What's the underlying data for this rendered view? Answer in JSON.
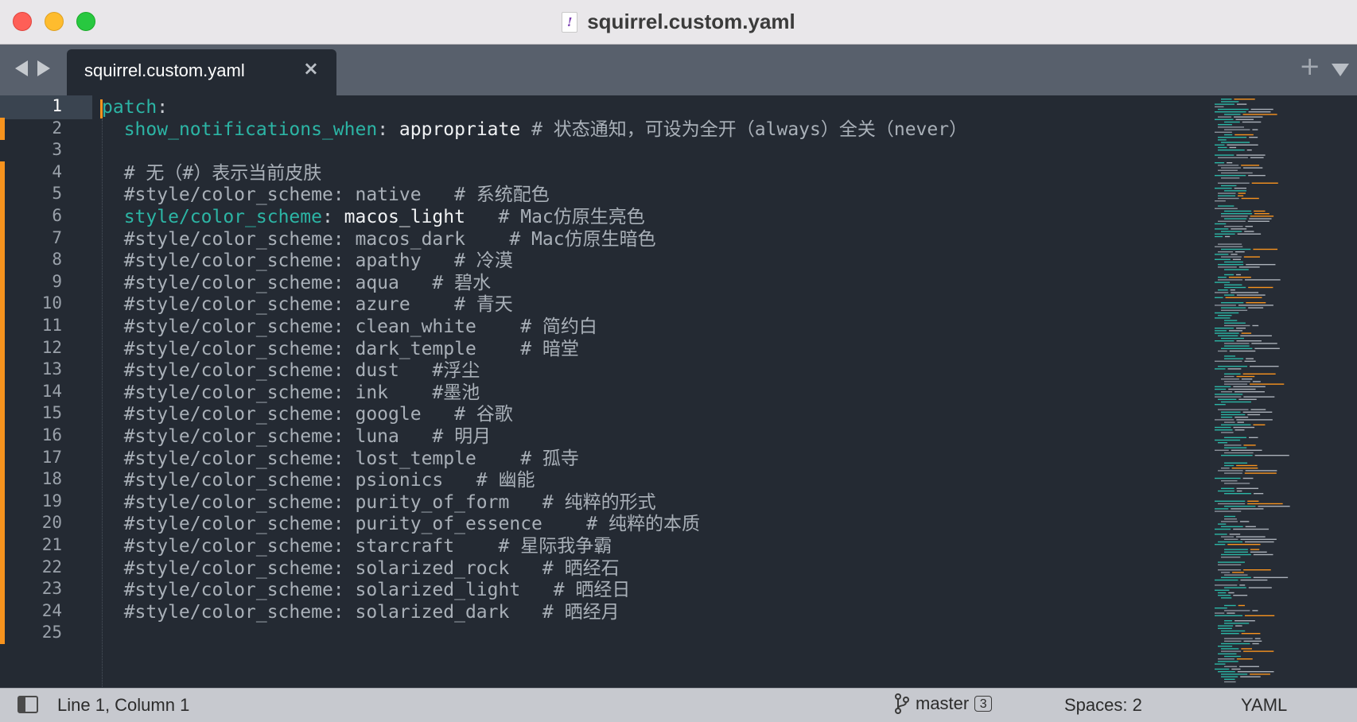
{
  "window": {
    "title": "squirrel.custom.yaml",
    "file_icon_glyph": "!"
  },
  "tabbar": {
    "tab_label": "squirrel.custom.yaml",
    "close_glyph": "×",
    "new_tab_glyph": "+"
  },
  "editor": {
    "current_line": 1,
    "lines": [
      {
        "num": "1",
        "parts": [
          {
            "t": "patch",
            "c": "key"
          },
          {
            "t": ":",
            "c": "sep"
          }
        ],
        "marked": false
      },
      {
        "num": "2",
        "parts": [
          {
            "t": "  ",
            "c": "cmt"
          },
          {
            "t": "show_notifications_when",
            "c": "key"
          },
          {
            "t": ": ",
            "c": "sep"
          },
          {
            "t": "appropriate",
            "c": "val"
          },
          {
            "t": " # 状态通知，可设为全开（always）全关（never）",
            "c": "cmt"
          }
        ],
        "marked": true
      },
      {
        "num": "3",
        "parts": [],
        "marked": false
      },
      {
        "num": "4",
        "parts": [
          {
            "t": "  # 无（#）表示当前皮肤",
            "c": "cmt"
          }
        ],
        "marked": true
      },
      {
        "num": "5",
        "parts": [
          {
            "t": "  #style/color_scheme: native   # 系统配色",
            "c": "cmt"
          }
        ],
        "marked": true
      },
      {
        "num": "6",
        "parts": [
          {
            "t": "  ",
            "c": "cmt"
          },
          {
            "t": "style/color_scheme",
            "c": "key"
          },
          {
            "t": ": ",
            "c": "sep"
          },
          {
            "t": "macos_light",
            "c": "val"
          },
          {
            "t": "   # Mac仿原生亮色",
            "c": "cmt"
          }
        ],
        "marked": true
      },
      {
        "num": "7",
        "parts": [
          {
            "t": "  #style/color_scheme: macos_dark    # Mac仿原生暗色",
            "c": "cmt"
          }
        ],
        "marked": true
      },
      {
        "num": "8",
        "parts": [
          {
            "t": "  #style/color_scheme: apathy   # 冷漠",
            "c": "cmt"
          }
        ],
        "marked": true
      },
      {
        "num": "9",
        "parts": [
          {
            "t": "  #style/color_scheme: aqua   # 碧水",
            "c": "cmt"
          }
        ],
        "marked": true
      },
      {
        "num": "10",
        "parts": [
          {
            "t": "  #style/color_scheme: azure    # 青天",
            "c": "cmt"
          }
        ],
        "marked": true
      },
      {
        "num": "11",
        "parts": [
          {
            "t": "  #style/color_scheme: clean_white    # 简约白",
            "c": "cmt"
          }
        ],
        "marked": true
      },
      {
        "num": "12",
        "parts": [
          {
            "t": "  #style/color_scheme: dark_temple    # 暗堂",
            "c": "cmt"
          }
        ],
        "marked": true
      },
      {
        "num": "13",
        "parts": [
          {
            "t": "  #style/color_scheme: dust   #浮尘",
            "c": "cmt"
          }
        ],
        "marked": true
      },
      {
        "num": "14",
        "parts": [
          {
            "t": "  #style/color_scheme: ink    #墨池",
            "c": "cmt"
          }
        ],
        "marked": true
      },
      {
        "num": "15",
        "parts": [
          {
            "t": "  #style/color_scheme: google   # 谷歌",
            "c": "cmt"
          }
        ],
        "marked": true
      },
      {
        "num": "16",
        "parts": [
          {
            "t": "  #style/color_scheme: luna   # 明月",
            "c": "cmt"
          }
        ],
        "marked": true
      },
      {
        "num": "17",
        "parts": [
          {
            "t": "  #style/color_scheme: lost_temple    # 孤寺",
            "c": "cmt"
          }
        ],
        "marked": true
      },
      {
        "num": "18",
        "parts": [
          {
            "t": "  #style/color_scheme: psionics   # 幽能",
            "c": "cmt"
          }
        ],
        "marked": true
      },
      {
        "num": "19",
        "parts": [
          {
            "t": "  #style/color_scheme: purity_of_form   # 纯粹的形式",
            "c": "cmt"
          }
        ],
        "marked": true
      },
      {
        "num": "20",
        "parts": [
          {
            "t": "  #style/color_scheme: purity_of_essence    # 纯粹的本质",
            "c": "cmt"
          }
        ],
        "marked": true
      },
      {
        "num": "21",
        "parts": [
          {
            "t": "  #style/color_scheme: starcraft    # 星际我争霸",
            "c": "cmt"
          }
        ],
        "marked": true
      },
      {
        "num": "22",
        "parts": [
          {
            "t": "  #style/color_scheme: solarized_rock   # 晒经石",
            "c": "cmt"
          }
        ],
        "marked": true
      },
      {
        "num": "23",
        "parts": [
          {
            "t": "  #style/color_scheme: solarized_light   # 晒经日",
            "c": "cmt"
          }
        ],
        "marked": true
      },
      {
        "num": "24",
        "parts": [
          {
            "t": "  #style/color_scheme: solarized_dark   # 晒经月",
            "c": "cmt"
          }
        ],
        "marked": true
      },
      {
        "num": "25",
        "parts": [],
        "marked": true
      }
    ]
  },
  "statusbar": {
    "position": "Line 1, Column 1",
    "branch": "master",
    "branch_badge": "3",
    "indent": "Spaces: 2",
    "syntax": "YAML"
  },
  "colors": {
    "editor_bg": "#242a33",
    "key": "#2cb5a5",
    "value": "#f0f2f4",
    "comment": "#a9b0b8",
    "modified_marker": "#f7931e",
    "cursor": "#f7931e"
  },
  "icons": {
    "close": "close-icon",
    "minimize": "minimize-icon",
    "maximize": "maximize-icon",
    "back": "chevron-left-icon",
    "forward": "chevron-right-icon",
    "tab_close": "close-icon",
    "new_tab": "plus-icon",
    "tab_menu": "chevron-down-icon",
    "sidebar_toggle": "sidebar-icon",
    "git_branch": "git-branch-icon"
  }
}
